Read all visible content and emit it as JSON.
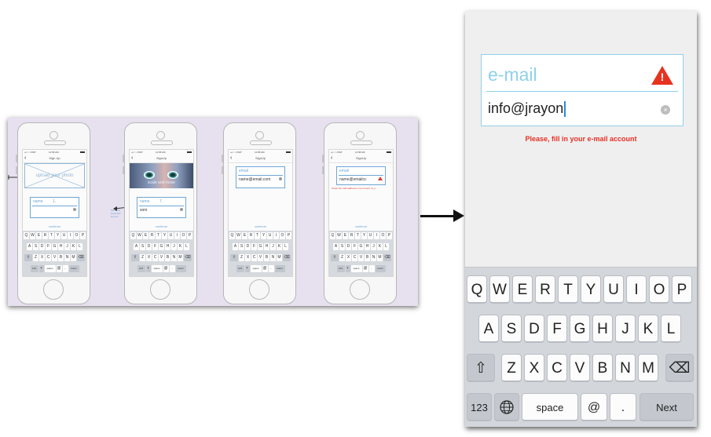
{
  "board": {
    "frames": [
      {
        "nav_title": "Sign Up",
        "status_left": "•••○○ AT&T",
        "status_time": "11:58 AM",
        "photo_label": "upload your photo",
        "field_label": "name",
        "field_hint": "1.",
        "field_value": "",
        "continue": "continue"
      },
      {
        "nav_title": "SignUp",
        "status_left": "•••○○ AT&T",
        "status_time": "11:58 AM",
        "photo_label": "scale and move",
        "field_label": "name",
        "field_hint": "7.",
        "field_value": "soni",
        "continue": "continue"
      },
      {
        "nav_title": "SignUp",
        "status_left": "•••○○ AT&T",
        "status_time": "11:58 AM",
        "field_label": "email",
        "field_value": "name@email.com",
        "continue": "continue"
      },
      {
        "nav_title": "SignUp",
        "status_left": "•••○○ AT&T",
        "status_time": "11:58 AM",
        "field_label": "email",
        "field_value": "name@emailcc",
        "error": "Oops! the mail address is not correct :O_o",
        "continue": "continue"
      }
    ],
    "mini_keyboard": {
      "row1": [
        "Q",
        "W",
        "E",
        "R",
        "T",
        "Y",
        "U",
        "I",
        "O",
        "P"
      ],
      "row2": [
        "A",
        "S",
        "D",
        "F",
        "G",
        "H",
        "J",
        "K",
        "L"
      ],
      "row3": [
        "Z",
        "X",
        "C",
        "V",
        "B",
        "N",
        "M"
      ],
      "row4": [
        "123",
        "space",
        "@",
        ".",
        "return"
      ]
    },
    "note": "Move the keyboard layover"
  },
  "detail": {
    "field_label": "e-mail",
    "field_value": "info@jrayon",
    "error_message": "Please, fill in your e-mail account",
    "keyboard": {
      "row1": [
        "Q",
        "W",
        "E",
        "R",
        "T",
        "Y",
        "U",
        "I",
        "O",
        "P"
      ],
      "row2": [
        "A",
        "S",
        "D",
        "F",
        "G",
        "H",
        "J",
        "K",
        "L"
      ],
      "row3": [
        "Z",
        "X",
        "C",
        "V",
        "B",
        "N",
        "M"
      ],
      "key_123": "123",
      "key_space": "space",
      "key_at": "@",
      "key_dot": ".",
      "key_next": "Next"
    }
  },
  "colors": {
    "accent": "#8fd0ea",
    "error": "#e63126",
    "board_bg": "#e7e0ef"
  },
  "icons": [
    "back-chevron-icon",
    "warning-icon",
    "clear-icon",
    "shift-icon",
    "delete-icon",
    "globe-icon",
    "mic-icon",
    "arrow-right-icon"
  ]
}
